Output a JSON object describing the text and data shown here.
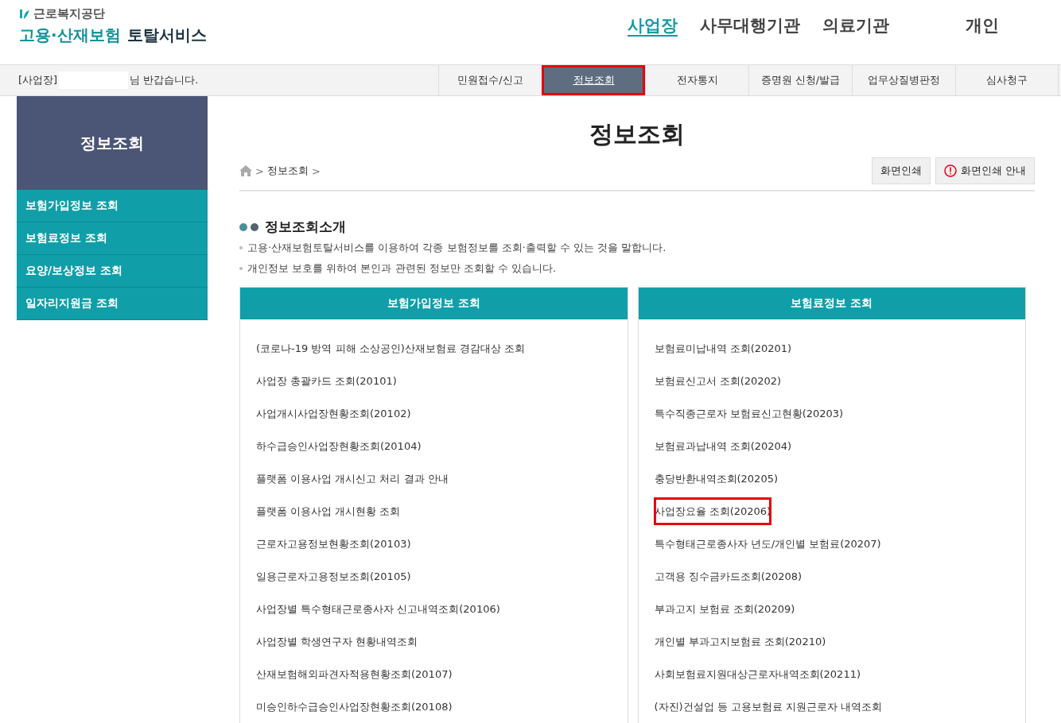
{
  "header": {
    "org_name": "근로복지공단",
    "service_title_part1": "고용·산재보험",
    "service_title_part2": "토탈서비스",
    "top_nav": [
      {
        "label": "사업장",
        "selected": true
      },
      {
        "label": "사무대행기관",
        "selected": false
      },
      {
        "label": "의료기관",
        "selected": false
      },
      {
        "label": "개인",
        "selected": false
      }
    ]
  },
  "user_bar": {
    "role": "[사업장]",
    "greeting": "님 반갑습니다.",
    "tabs": [
      {
        "label": "민원접수/신고",
        "selected": false,
        "highlighted": false
      },
      {
        "label": "정보조회",
        "selected": true,
        "highlighted": true
      },
      {
        "label": "전자통지",
        "selected": false,
        "highlighted": false
      },
      {
        "label": "증명원 신청/발급",
        "selected": false,
        "highlighted": false
      },
      {
        "label": "업무상질병판정",
        "selected": false,
        "highlighted": false
      },
      {
        "label": "심사청구",
        "selected": false,
        "highlighted": false
      }
    ]
  },
  "sidebar": {
    "title": "정보조회",
    "items": [
      "보험가입정보 조회",
      "보험료정보 조회",
      "요양/보상정보 조회",
      "일자리지원금 조회"
    ]
  },
  "page": {
    "title": "정보조회",
    "breadcrumb": [
      ">",
      "정보조회",
      ">"
    ],
    "buttons": [
      {
        "label": "화면인쇄",
        "kind": "plain"
      },
      {
        "label": "화면인쇄 안내",
        "kind": "info"
      }
    ],
    "section_title": "정보조회소개",
    "notes": [
      "고용·산재보험토탈서비스를 이용하여 각종 보험정보를 조회·출력할 수 있는 것을 말합니다.",
      "개인정보 보호를 위하여 본인과 관련된 정보만 조회할 수 있습니다."
    ],
    "panels": [
      {
        "title": "보험가입정보 조회",
        "items": [
          {
            "label": "(코로나-19 방역 피해 소상공인)산재보험료 경감대상 조회",
            "highlighted": false
          },
          {
            "label": "사업장 총괄카드 조회(20101)",
            "highlighted": false
          },
          {
            "label": "사업개시사업장현황조회(20102)",
            "highlighted": false
          },
          {
            "label": "하수급승인사업장현황조회(20104)",
            "highlighted": false
          },
          {
            "label": "플랫폼 이용사업 개시신고 처리 결과 안내",
            "highlighted": false
          },
          {
            "label": "플랫폼 이용사업 개시현황 조회",
            "highlighted": false
          },
          {
            "label": "근로자고용정보현황조회(20103)",
            "highlighted": false
          },
          {
            "label": "일용근로자고용정보조회(20105)",
            "highlighted": false
          },
          {
            "label": "사업장별 특수형태근로종사자 신고내역조회(20106)",
            "highlighted": false
          },
          {
            "label": "사업장별 학생연구자 현황내역조회",
            "highlighted": false
          },
          {
            "label": "산재보험해외파견자적용현황조회(20107)",
            "highlighted": false
          },
          {
            "label": "미승인하수급승인사업장현황조회(20108)",
            "highlighted": false
          }
        ]
      },
      {
        "title": "보험료정보 조회",
        "items": [
          {
            "label": "보험료미납내역 조회(20201)",
            "highlighted": false
          },
          {
            "label": "보험료신고서 조회(20202)",
            "highlighted": false
          },
          {
            "label": "특수직종근로자 보험료신고현황(20203)",
            "highlighted": false
          },
          {
            "label": "보험료과납내역 조회(20204)",
            "highlighted": false
          },
          {
            "label": "충당반환내역조회(20205)",
            "highlighted": false
          },
          {
            "label": "사업장요율 조회(20206)",
            "highlighted": true
          },
          {
            "label": "특수형태근로종사자 년도/개인별 보험료(20207)",
            "highlighted": false
          },
          {
            "label": "고객용 징수금카드조회(20208)",
            "highlighted": false
          },
          {
            "label": "부과고지 보험료 조회(20209)",
            "highlighted": false
          },
          {
            "label": "개인별 부과고지보험료 조회(20210)",
            "highlighted": false
          },
          {
            "label": "사회보험료지원대상근로자내역조회(20211)",
            "highlighted": false
          },
          {
            "label": "(자진)건설업 등 고용보험료 지원근로자 내역조회",
            "highlighted": false
          }
        ]
      }
    ]
  }
}
